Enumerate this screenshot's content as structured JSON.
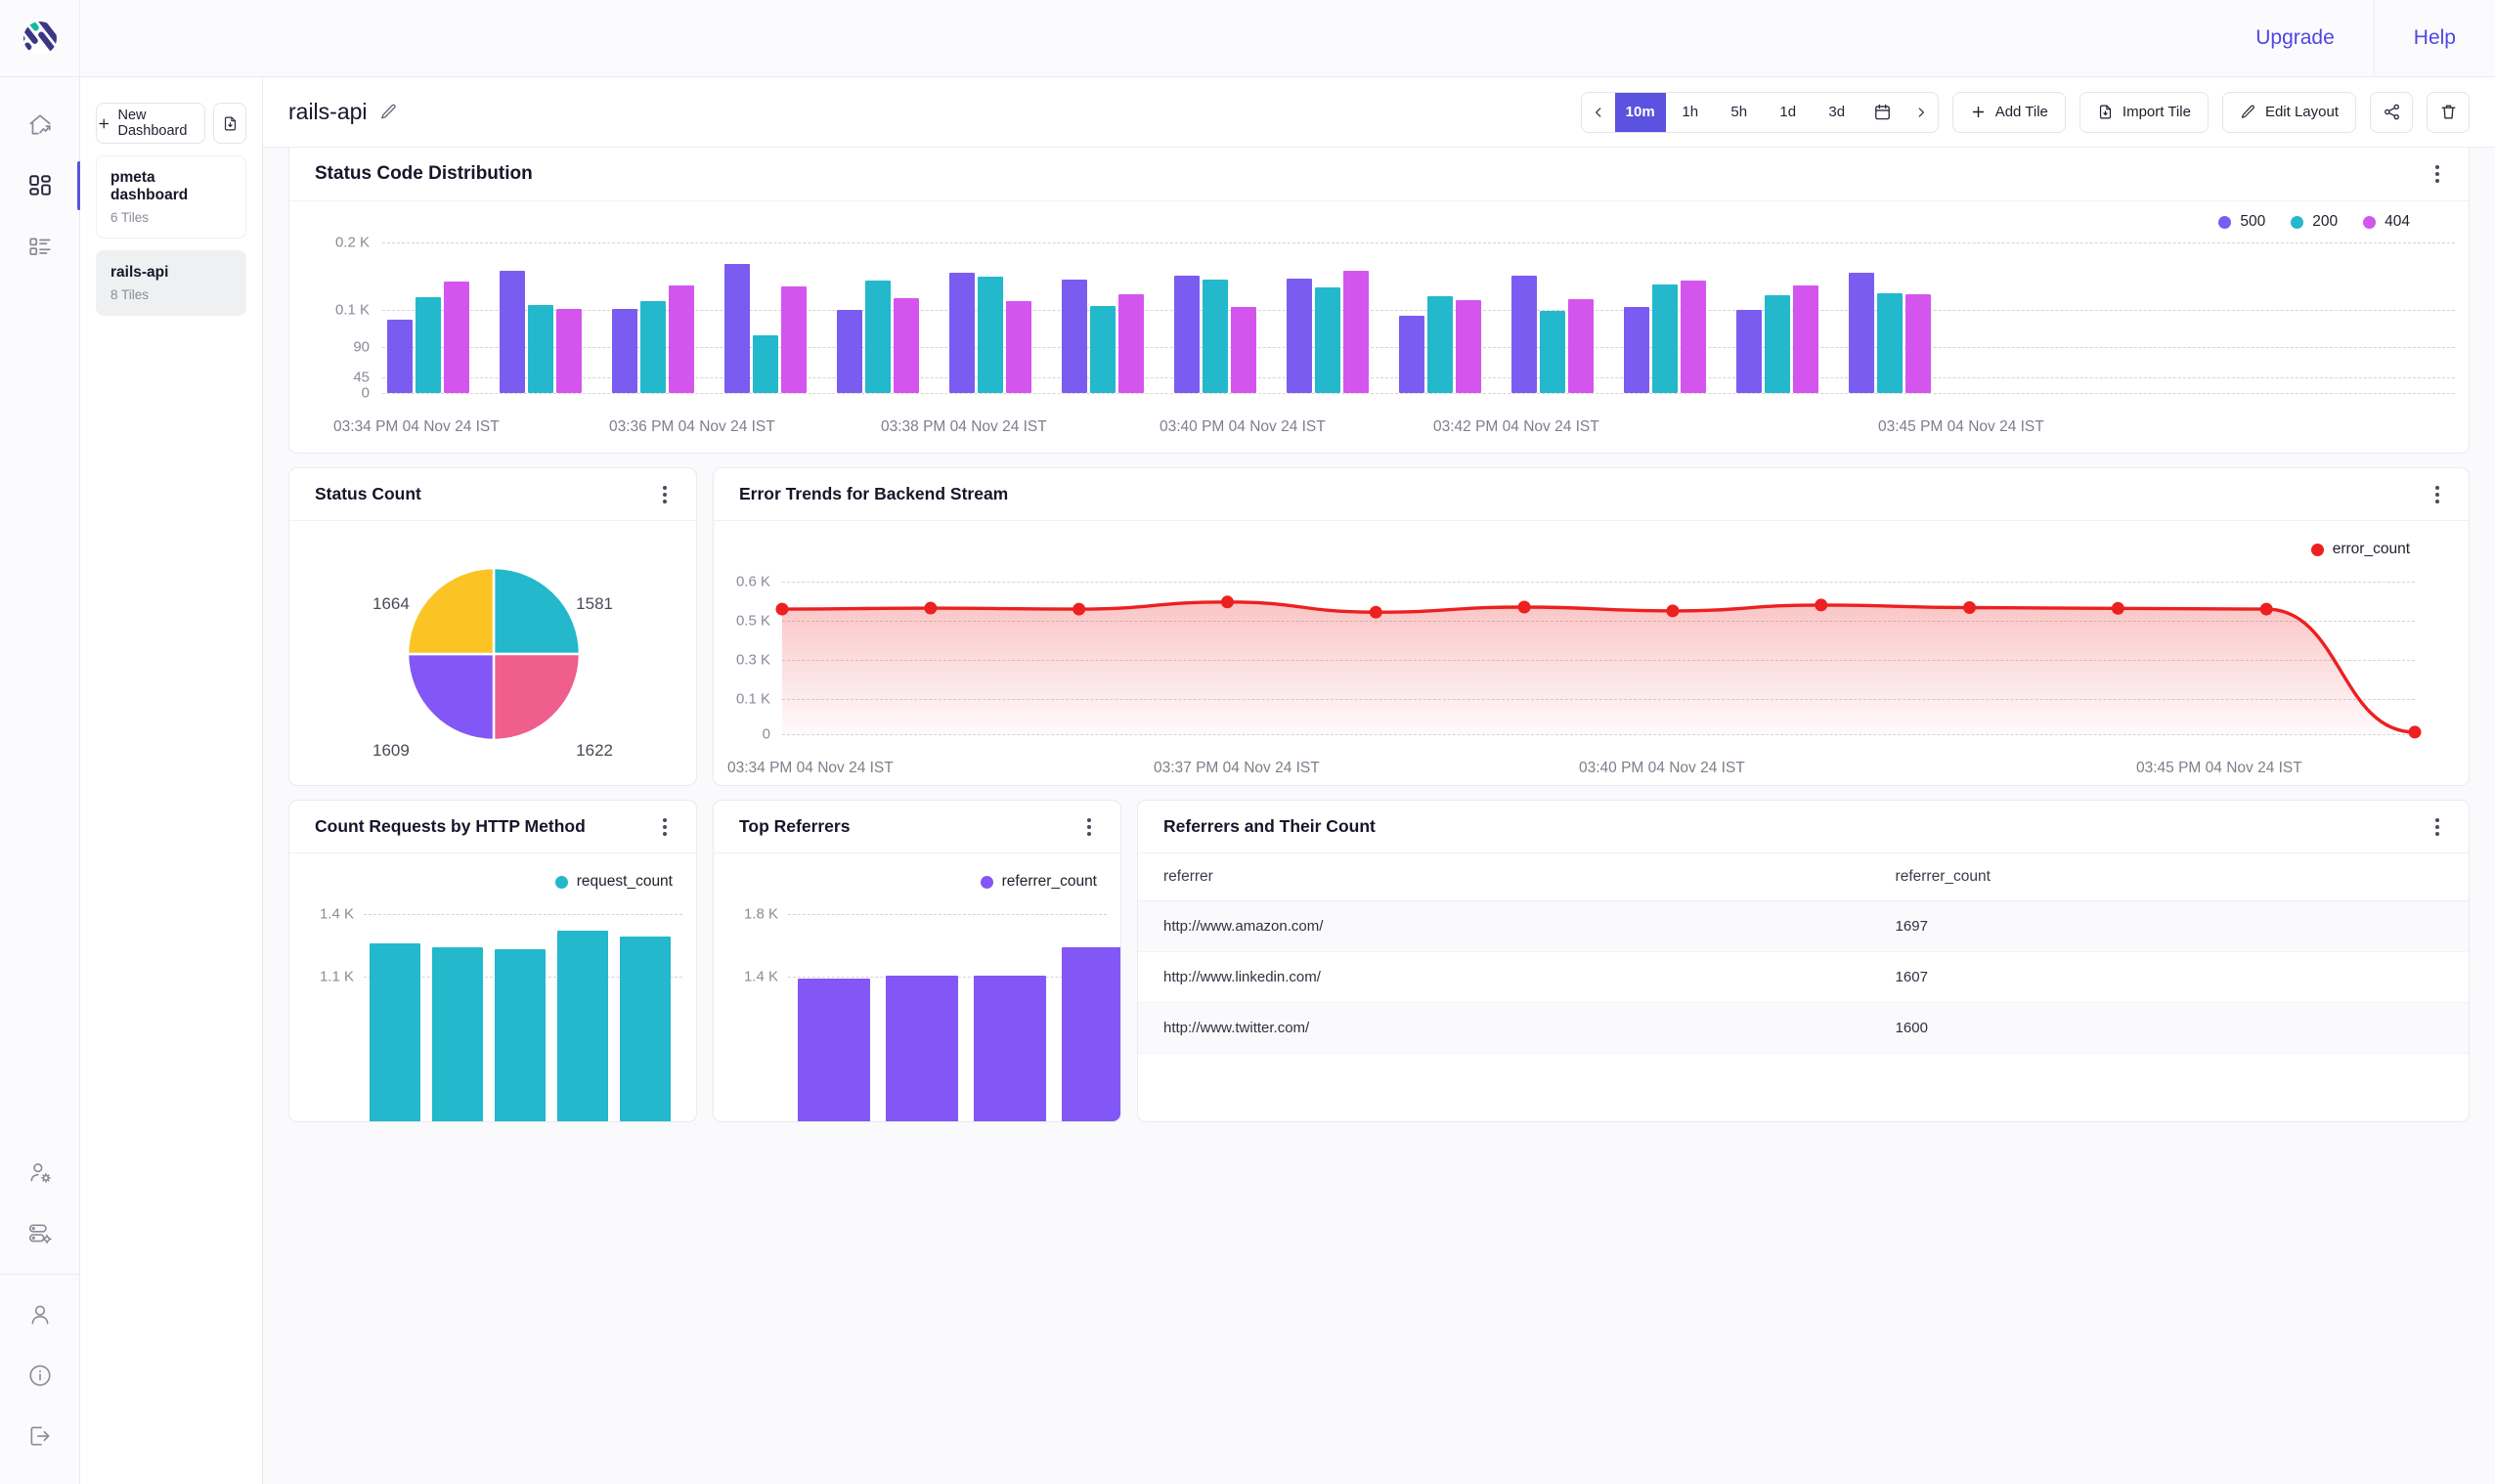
{
  "topbar": {
    "logo": "parseable-logo",
    "upgrade_label": "Upgrade",
    "help_label": "Help"
  },
  "rail": {
    "items": [
      {
        "name": "home-analytics",
        "icon": "home-trend-icon",
        "active": false
      },
      {
        "name": "dashboards",
        "icon": "dashboard-grid-icon",
        "active": true
      },
      {
        "name": "streams-list",
        "icon": "list-view-icon",
        "active": false
      }
    ],
    "bottom_items": [
      {
        "name": "user-settings",
        "icon": "user-gear-icon"
      },
      {
        "name": "server-settings",
        "icon": "server-gear-icon"
      },
      {
        "name": "profile",
        "icon": "user-icon"
      },
      {
        "name": "about-info",
        "icon": "info-circle-icon"
      },
      {
        "name": "logout",
        "icon": "logout-icon"
      }
    ]
  },
  "dashboard_panel": {
    "new_dashboard_label": "New Dashboard",
    "import_icon": "file-import-icon",
    "items": [
      {
        "name": "pmeta dashboard",
        "tiles": "6 Tiles",
        "selected": false
      },
      {
        "name": "rails-api",
        "tiles": "8 Tiles",
        "selected": true
      }
    ]
  },
  "toolbar": {
    "dashboard_title": "rails-api",
    "edit_title_icon": "pencil-icon",
    "prev_icon": "chevron-left-icon",
    "next_icon": "chevron-right-icon",
    "calendar_icon": "calendar-icon",
    "ranges": [
      "10m",
      "1h",
      "5h",
      "1d",
      "3d"
    ],
    "active_range": "10m",
    "add_tile_label": "Add Tile",
    "import_tile_label": "Import Tile",
    "edit_layout_label": "Edit Layout",
    "share_icon": "share-icon",
    "delete_icon": "trash-icon"
  },
  "colors": {
    "purple": "#7b5cf0",
    "teal": "#23b8cc",
    "magenta": "#d455ee",
    "yellow": "#fac424",
    "pink": "#ef5e8c",
    "violet": "#8257f5",
    "red": "#ec2020",
    "accent": "#5b52e0",
    "link": "#4f46e5"
  },
  "tiles": [
    {
      "id": "status-code-distribution",
      "title": "Status Code Distribution",
      "menu_icon": "kebab-menu-icon"
    },
    {
      "id": "status-count",
      "title": "Status Count",
      "menu_icon": "kebab-menu-icon"
    },
    {
      "id": "error-trends-backend-stream",
      "title": "Error Trends for Backend Stream",
      "menu_icon": "kebab-menu-icon"
    },
    {
      "id": "count-requests-by-http-method",
      "title": "Count Requests by HTTP Method",
      "menu_icon": "kebab-menu-icon"
    },
    {
      "id": "top-referrers",
      "title": "Top Referrers",
      "menu_icon": "kebab-menu-icon"
    },
    {
      "id": "referrers-and-their-count",
      "title": "Referrers and Their Count",
      "menu_icon": "kebab-menu-icon"
    }
  ],
  "chart_data": [
    {
      "id": "status-code-distribution",
      "type": "bar",
      "title": "Status Code Distribution",
      "xlabel": "",
      "ylabel": "",
      "grid": true,
      "legend_position": "top-right",
      "yticks": [
        "0",
        "45",
        "90",
        "0.1 K",
        "0.2 K"
      ],
      "ytickvals": [
        0,
        45,
        90,
        100,
        200
      ],
      "ylim": [
        0,
        200
      ],
      "xticks": [
        "03:34 PM 04 Nov 24 IST",
        "03:36 PM 04 Nov 24 IST",
        "03:38 PM 04 Nov 24 IST",
        "03:40 PM 04 Nov 24 IST",
        "03:42 PM 04 Nov 24 IST",
        "03:45 PM 04 Nov 24 IST"
      ],
      "legend": [
        "500",
        "200",
        "404"
      ],
      "series": [
        {
          "name": "500",
          "color": "#7b5cf0",
          "values": [
            97,
            163,
            112,
            172,
            110,
            160,
            151,
            156,
            152,
            102,
            156,
            114,
            110,
            160
          ]
        },
        {
          "name": "200",
          "color": "#23b8cc",
          "values": [
            127,
            117,
            122,
            76,
            150,
            154,
            115,
            151,
            140,
            128,
            109,
            144,
            130,
            133
          ]
        },
        {
          "name": "404",
          "color": "#d455ee",
          "values": [
            148,
            112,
            143,
            142,
            126,
            122,
            131,
            114,
            163,
            124,
            125,
            150,
            143,
            131
          ]
        }
      ]
    },
    {
      "id": "status-count",
      "type": "pie",
      "title": "Status Count",
      "labels": [
        "1581",
        "1622",
        "1609",
        "1664"
      ],
      "values": [
        1581,
        1622,
        1609,
        1664
      ],
      "colors": [
        "#23b8cc",
        "#ef5e8c",
        "#8257f5",
        "#fac424"
      ],
      "label_positions": [
        "top-right",
        "bottom-right",
        "bottom-left",
        "top-left"
      ]
    },
    {
      "id": "error-trends-backend-stream",
      "type": "area",
      "title": "Error Trends for Backend Stream",
      "grid": true,
      "legend": [
        "error_count"
      ],
      "legend_position": "top-right",
      "series_color": "#ec2020",
      "yticks": [
        "0",
        "0.1 K",
        "0.3 K",
        "0.5 K",
        "0.6 K"
      ],
      "ytickvals": [
        0,
        100,
        300,
        500,
        600
      ],
      "ylim": [
        0,
        600
      ],
      "xticks": [
        "03:34 PM 04 Nov 24 IST",
        "03:37 PM 04 Nov 24 IST",
        "03:40 PM 04 Nov 24 IST",
        "03:45 PM 04 Nov 24 IST"
      ],
      "values": [
        492,
        496,
        492,
        520,
        480,
        500,
        485,
        508,
        498,
        495,
        492,
        8
      ]
    },
    {
      "id": "count-requests-by-http-method",
      "type": "bar",
      "title": "Count Requests by HTTP Method",
      "grid": true,
      "legend": [
        "request_count"
      ],
      "legend_position": "top-right",
      "series_color": "#23b8cc",
      "yticks": [
        "1.1 K",
        "1.4 K"
      ],
      "ytickvals": [
        1100,
        1400
      ],
      "values": [
        1330,
        1320,
        1315,
        1360,
        1345
      ]
    },
    {
      "id": "top-referrers",
      "type": "bar",
      "title": "Top Referrers",
      "grid": true,
      "legend": [
        "referrer_count"
      ],
      "legend_position": "top-right",
      "series_color": "#8257f5",
      "yticks": [
        "1.4 K",
        "1.8 K"
      ],
      "ytickvals": [
        1400,
        1800
      ],
      "values": [
        1600,
        1607,
        1607,
        1697
      ]
    }
  ],
  "referrers_table": {
    "columns": [
      "referrer",
      "referrer_count"
    ],
    "rows": [
      {
        "referrer": "http://www.amazon.com/",
        "referrer_count": "1697"
      },
      {
        "referrer": "http://www.linkedin.com/",
        "referrer_count": "1607"
      },
      {
        "referrer": "http://www.twitter.com/",
        "referrer_count": "1600"
      }
    ]
  }
}
